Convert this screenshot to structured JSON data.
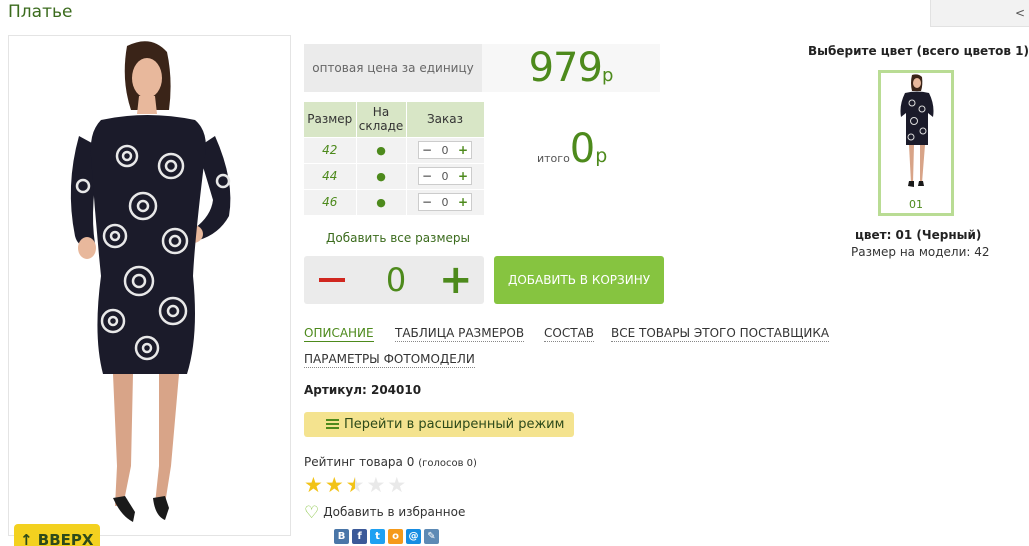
{
  "product": {
    "title": "Платье",
    "corner_label": "<",
    "price_label": "оптовая цена за единицу",
    "price_value": "979",
    "price_currency": "р",
    "table_headers": {
      "size": "Размер",
      "stock": "На складе",
      "order": "Заказ"
    },
    "rows": [
      {
        "size": "42",
        "stock": "●",
        "minus": "−",
        "qty": "0",
        "plus": "+"
      },
      {
        "size": "44",
        "stock": "●",
        "minus": "−",
        "qty": "0",
        "plus": "+"
      },
      {
        "size": "46",
        "stock": "●",
        "minus": "−",
        "qty": "0",
        "plus": "+"
      }
    ],
    "total_label": "итого",
    "total_value": "0",
    "total_currency": "р",
    "add_all_sizes": "Добавить все размеры",
    "qty_value": "0",
    "add_to_cart": "ДОБАВИТЬ В КОРЗИНУ",
    "tabs": [
      "ОПИСАНИЕ",
      "ТАБЛИЦА РАЗМЕРОВ",
      "СОСТАВ",
      "ВСЕ ТОВАРЫ ЭТОГО ПОСТАВЩИКА",
      "ПАРАМЕТРЫ ФОТОМОДЕЛИ"
    ],
    "article": "Артикул: 204010",
    "extended_mode": "Перейти в расширенный режим",
    "rating_label": "Рейтинг товара 0",
    "rating_votes": "(голосов 0)",
    "rating_filled_stars": 2.5,
    "favorite": "Добавить в избранное",
    "up_button": "ВВЕРХ",
    "colors_header": "Выберите цвет (всего цветов 1)",
    "swatch_code": "01",
    "color_name": "цвет: 01 (Черный)",
    "model_size": "Размер на модели: 42",
    "social": [
      {
        "icon": "vk-icon",
        "glyph": "В",
        "color": "#4a76a8"
      },
      {
        "icon": "facebook-icon",
        "glyph": "f",
        "color": "#3b5998"
      },
      {
        "icon": "twitter-icon",
        "glyph": "t",
        "color": "#1da1f2"
      },
      {
        "icon": "odnoklassniki-icon",
        "glyph": "о",
        "color": "#f59a1a"
      },
      {
        "icon": "mailru-icon",
        "glyph": "@",
        "color": "#168de2"
      },
      {
        "icon": "livejournal-icon",
        "glyph": "✎",
        "color": "#5d8ab5"
      }
    ]
  },
  "colors": {
    "accent": "#4d8a1c",
    "button": "#86c440",
    "highlight": "#f4e38f",
    "star": "#f2c318"
  }
}
